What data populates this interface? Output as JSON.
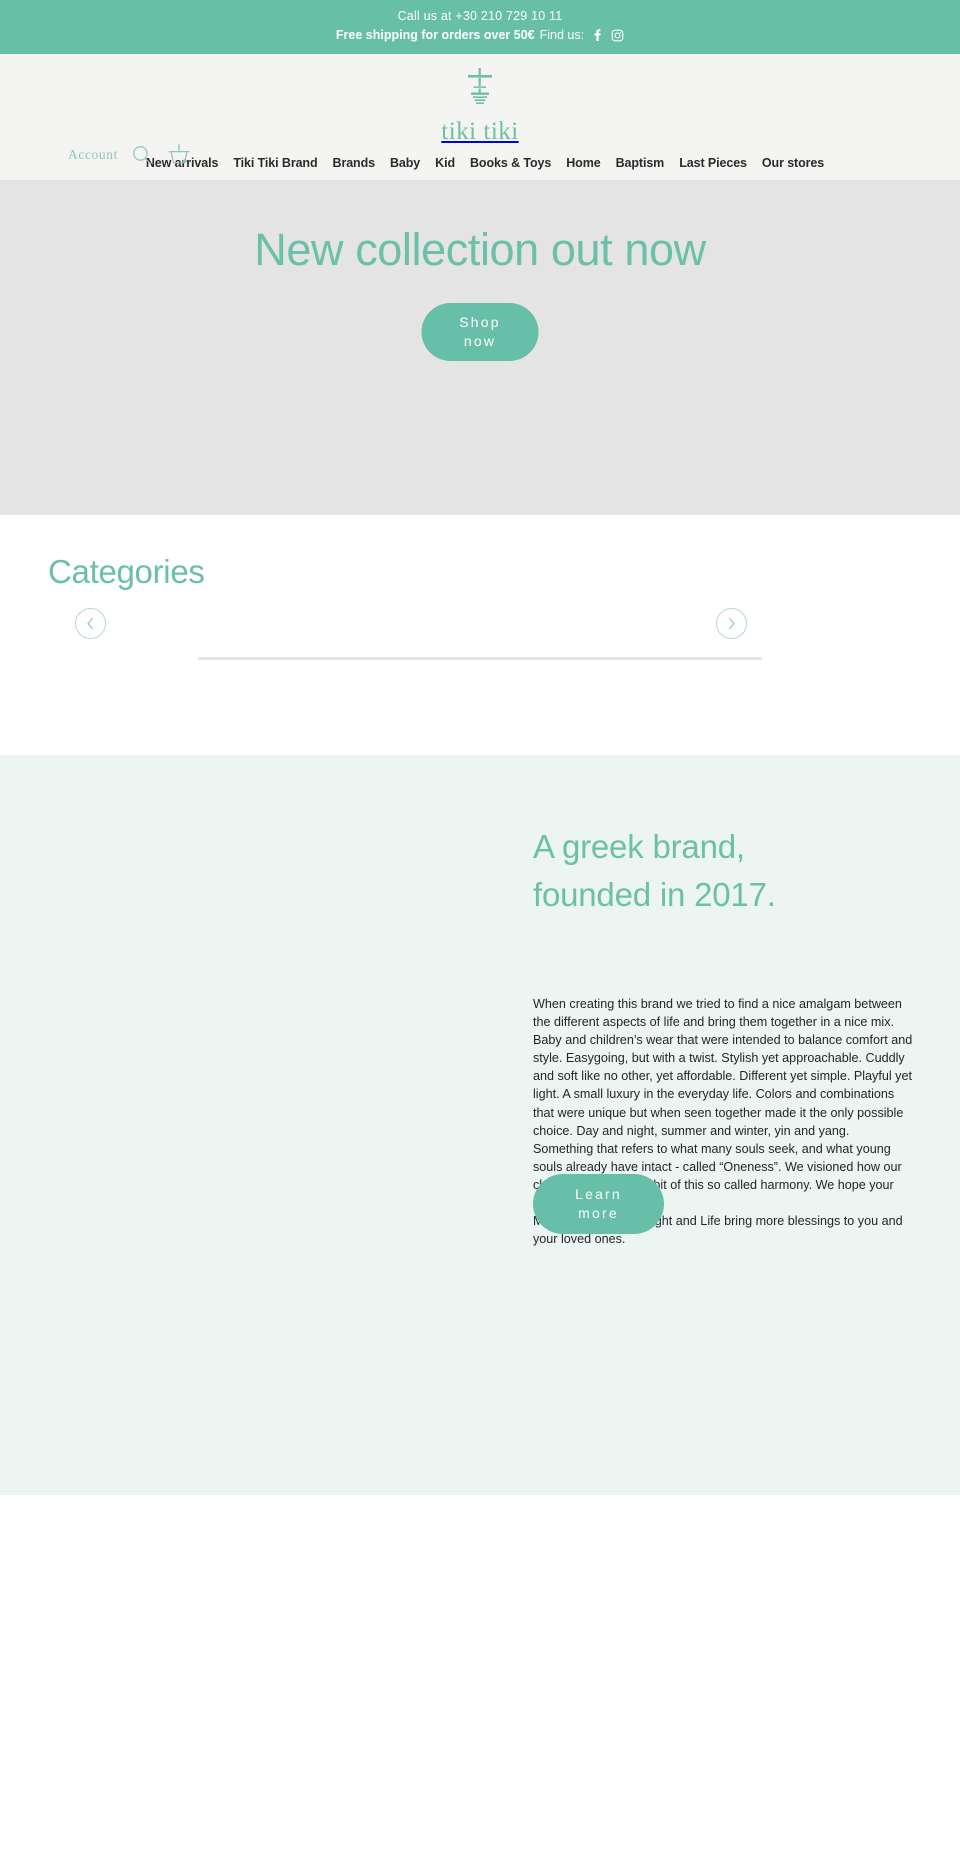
{
  "announcement": {
    "phone_line": "Call us at +30 210 729 10 11",
    "shipping": "Free shipping for orders over 50€",
    "find_us": "Find us:",
    "facebook_icon": "facebook-icon",
    "instagram_icon": "instagram-icon",
    "background": "#67bfa6"
  },
  "header": {
    "logo_mark": "tiki-totem-icon",
    "logo_text": "tiki tiki",
    "account_label": "Account",
    "search_icon": "search-icon",
    "cart_icon": "shopping-basket-icon",
    "nav": [
      {
        "label": "New arrivals"
      },
      {
        "label": "Tiki Tiki Brand"
      },
      {
        "label": "Brands"
      },
      {
        "label": "Baby"
      },
      {
        "label": "Kid"
      },
      {
        "label": "Books & Toys"
      },
      {
        "label": "Home"
      },
      {
        "label": "Baptism"
      },
      {
        "label": "Last Pieces"
      },
      {
        "label": "Our stores"
      }
    ]
  },
  "hero": {
    "title": "New collection out now",
    "cta_line1": "Shop",
    "cta_line2": "now",
    "background": "#e4e4e4",
    "accent": "#6cc0a8"
  },
  "categories": {
    "title": "Categories",
    "prev_icon": "chevron-left-icon",
    "next_icon": "chevron-right-icon"
  },
  "story": {
    "title_line1": "A greek brand,",
    "title_line2": "founded in 2017.",
    "paragraph1": "When creating this brand we tried to find a nice amalgam between the different aspects of life and bring them together in a nice mix. Baby and children’s wear that were intended to balance comfort and style. Easygoing, but with a twist. Stylish yet approachable. Cuddly and soft like no other, yet affordable. Different yet simple. Playful yet light. A small luxury in the everyday life. Colors and combinations that were unique but when seen together made it the only possible choice. Day and night, summer and winter, yin and yang. Something that refers to what many souls seek, and what young souls already have intact - called “Oneness”. We visioned how our clothes could show a bit of this so called harmony. We hope your Kids will enjoy them.",
    "paragraph2": "May the Tiki God of Light and Life bring more blessings to you and your loved ones.",
    "cta_line1": "Learn",
    "cta_line2": "more",
    "background": "#ecf5f2"
  }
}
